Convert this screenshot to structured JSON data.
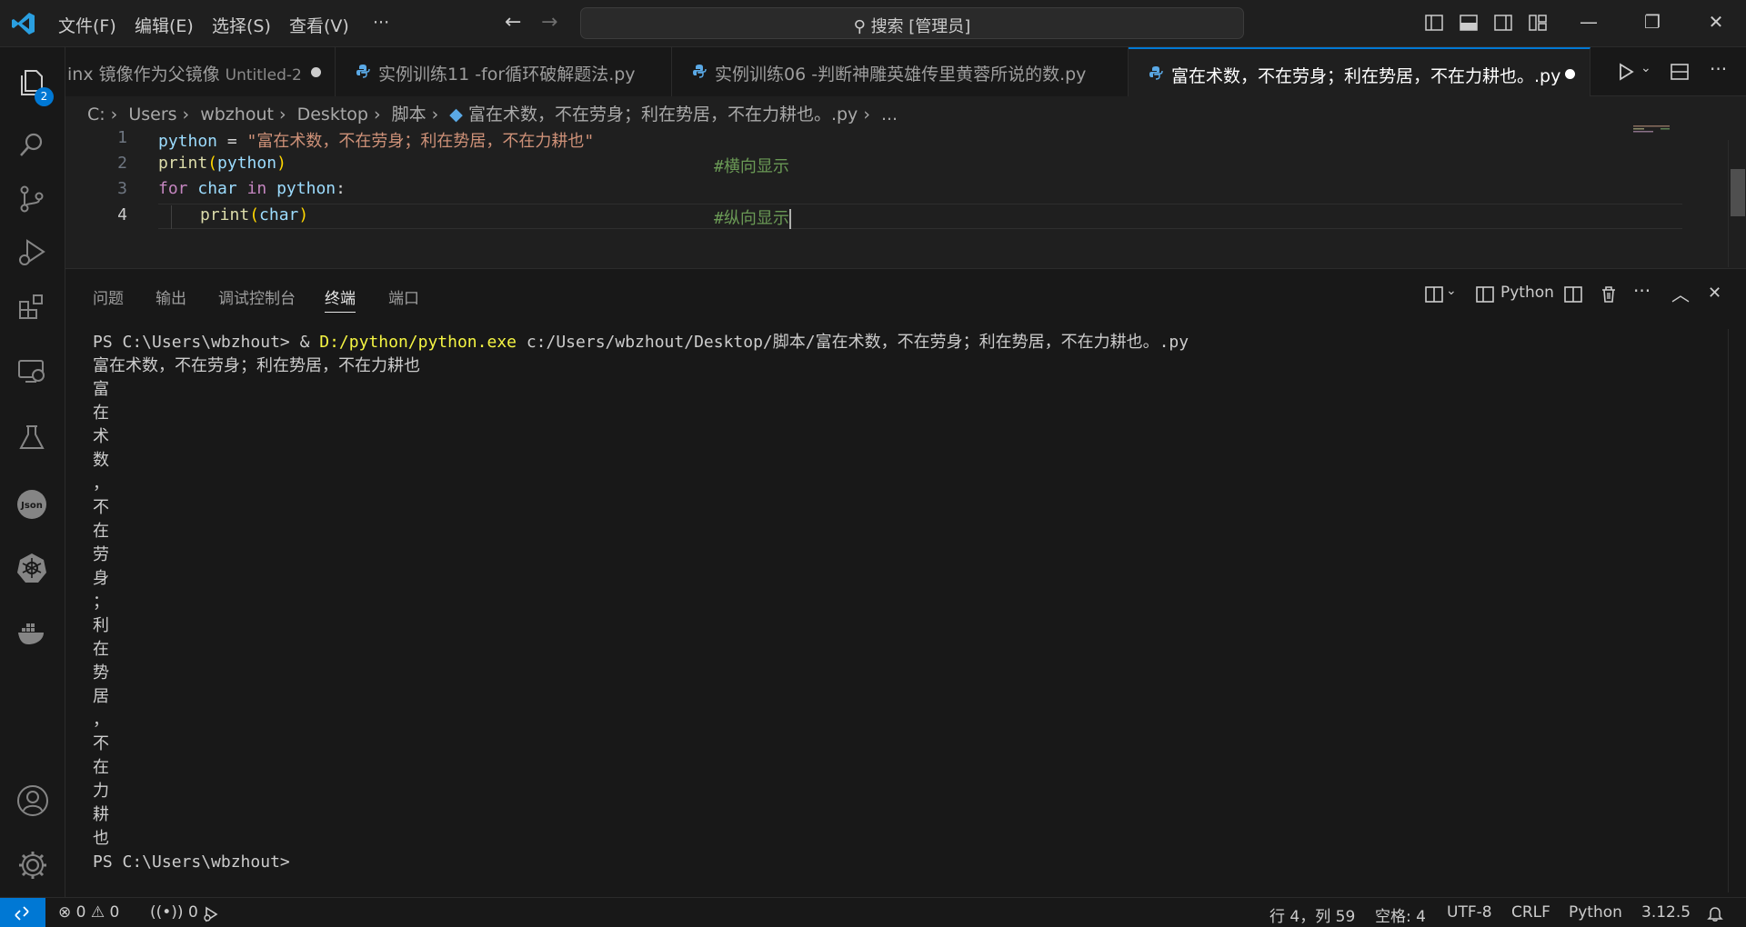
{
  "menu": {
    "file": "文件(F)",
    "edit": "编辑(E)",
    "selection": "选择(S)",
    "view": "查看(V)",
    "more": "···"
  },
  "search": {
    "label": "搜索 [管理员]"
  },
  "tabs": [
    {
      "label": "inx 镜像作为父镜像",
      "sub": "Untitled-2",
      "modified": true
    },
    {
      "label": "实例训练11 -for循环破解题法.py"
    },
    {
      "label": "实例训练06 -判断神雕英雄传里黄蓉所说的数.py"
    },
    {
      "label": "富在术数，不在劳身；利在势居，不在力耕也。.py",
      "modified": true,
      "active": true
    }
  ],
  "breadcrumb": [
    "C:",
    "Users",
    "wbzhout",
    "Desktop",
    "脚本",
    "富在术数，不在劳身；利在势居，不在力耕也。.py",
    "..."
  ],
  "editor": {
    "line_numbers": [
      "1",
      "2",
      "3",
      "4"
    ],
    "line1": {
      "var": "python",
      "op": " = ",
      "str": "\"富在术数，不在劳身；利在势居，不在力耕也\""
    },
    "line2": {
      "fn": "print",
      "open": "(",
      "arg": "python",
      "close": ")",
      "comment": "#横向显示"
    },
    "line3": {
      "kw1": "for",
      "v1": "char",
      "kw2": "in",
      "v2": "python",
      "colon": ":"
    },
    "line4": {
      "fn": "print",
      "open": "(",
      "arg": "char",
      "close": ")",
      "comment": "#纵向显示"
    }
  },
  "activity": {
    "explorer_badge": "2"
  },
  "panel": {
    "tabs": [
      "问题",
      "输出",
      "调试控制台",
      "终端",
      "端口"
    ],
    "active_tab": "终端",
    "terminal_profile": "Python"
  },
  "terminal": {
    "prompt1": "PS C:\\Users\\wbzhout> & ",
    "exe": "D:/python/python.exe",
    "args": " c:/Users/wbzhout/Desktop/脚本/富在术数，不在劳身；利在势居，不在力耕也。.py",
    "output_line": "富在术数，不在劳身；利在势居，不在力耕也",
    "chars": [
      "富",
      "在",
      "术",
      "数",
      "，",
      "不",
      "在",
      "劳",
      "身",
      "；",
      "利",
      "在",
      "势",
      "居",
      "，",
      "不",
      "在",
      "力",
      "耕",
      "也"
    ],
    "prompt2": "PS C:\\Users\\wbzhout>"
  },
  "status": {
    "errors": "0",
    "warnings": "0",
    "ports": "0",
    "position": "行 4，列 59",
    "spaces": "空格: 4",
    "encoding": "UTF-8",
    "eol": "CRLF",
    "language": "Python",
    "interpreter": "3.12.5"
  },
  "colors": {
    "accent": "#0078d4",
    "background": "#1f1f1f",
    "sidebar": "#181818"
  }
}
